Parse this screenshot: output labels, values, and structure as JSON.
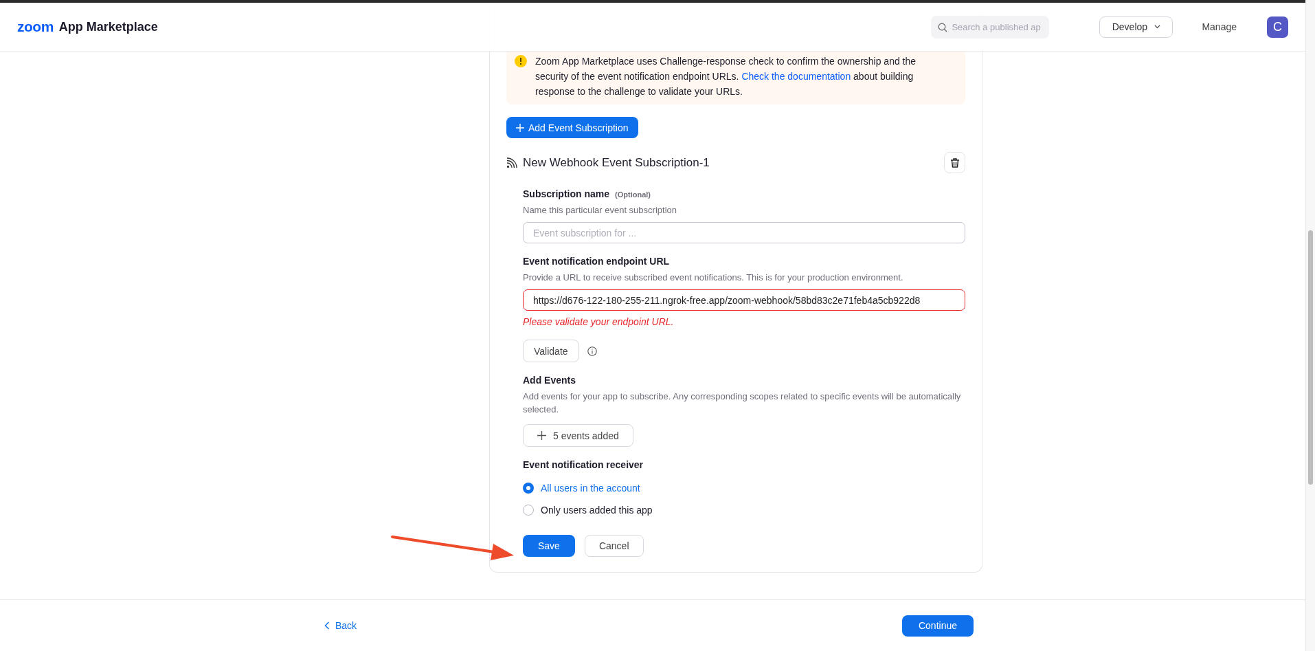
{
  "header": {
    "logo": "zoom",
    "title": "App Marketplace",
    "search": {
      "placeholder": "Search a published ap"
    },
    "menu": [
      {
        "label": "Develop",
        "kind": "dropdown"
      },
      {
        "label": "Manage",
        "kind": "link"
      }
    ],
    "avatar": "C"
  },
  "notice": {
    "text": "Zoom App Marketplace uses Challenge-response check to confirm the ownership and the security of the event notification endpoint URLs.",
    "link": "Check the documentation",
    "after": "about building response to the challenge to validate your URLs."
  },
  "add_button": "Add Event Subscription",
  "subscription": {
    "title": "New Webhook Event Subscription-1",
    "fields": [
      {
        "kind": "text",
        "label": "Subscription name",
        "optional": "(Optional)",
        "hint": "Name this particular event subscription",
        "placeholder": "Event subscription for ...",
        "invalid": false
      },
      {
        "kind": "text",
        "label": "Event notification endpoint URL",
        "hint": "Provide a URL to receive subscribed event notifications. This is for your production environment.",
        "value": "https://d676-122-180-255-211.ngrok-free.app/zoom-webhook/58bd83c2e71feb4a5cb922d8",
        "invalid": true,
        "error": "Please validate your endpoint URL.",
        "button": "Validate"
      },
      {
        "kind": "events",
        "label": "Add Events",
        "hint": "Add events for your app to subscribe. Any corresponding scopes related to specific events will be automatically selected.",
        "button": "5 events added"
      },
      {
        "kind": "radio",
        "label": "Event notification receiver",
        "options": [
          {
            "label": "All users in the account",
            "selected": true
          },
          {
            "label": "Only users added this app",
            "selected": false
          }
        ]
      }
    ],
    "actions": [
      {
        "label": "Save",
        "kind": "primary"
      },
      {
        "label": "Cancel",
        "kind": "secondary"
      }
    ]
  },
  "annotation": {
    "kind": "arrow"
  },
  "footer": {
    "back": "Back",
    "continue": "Continue"
  }
}
